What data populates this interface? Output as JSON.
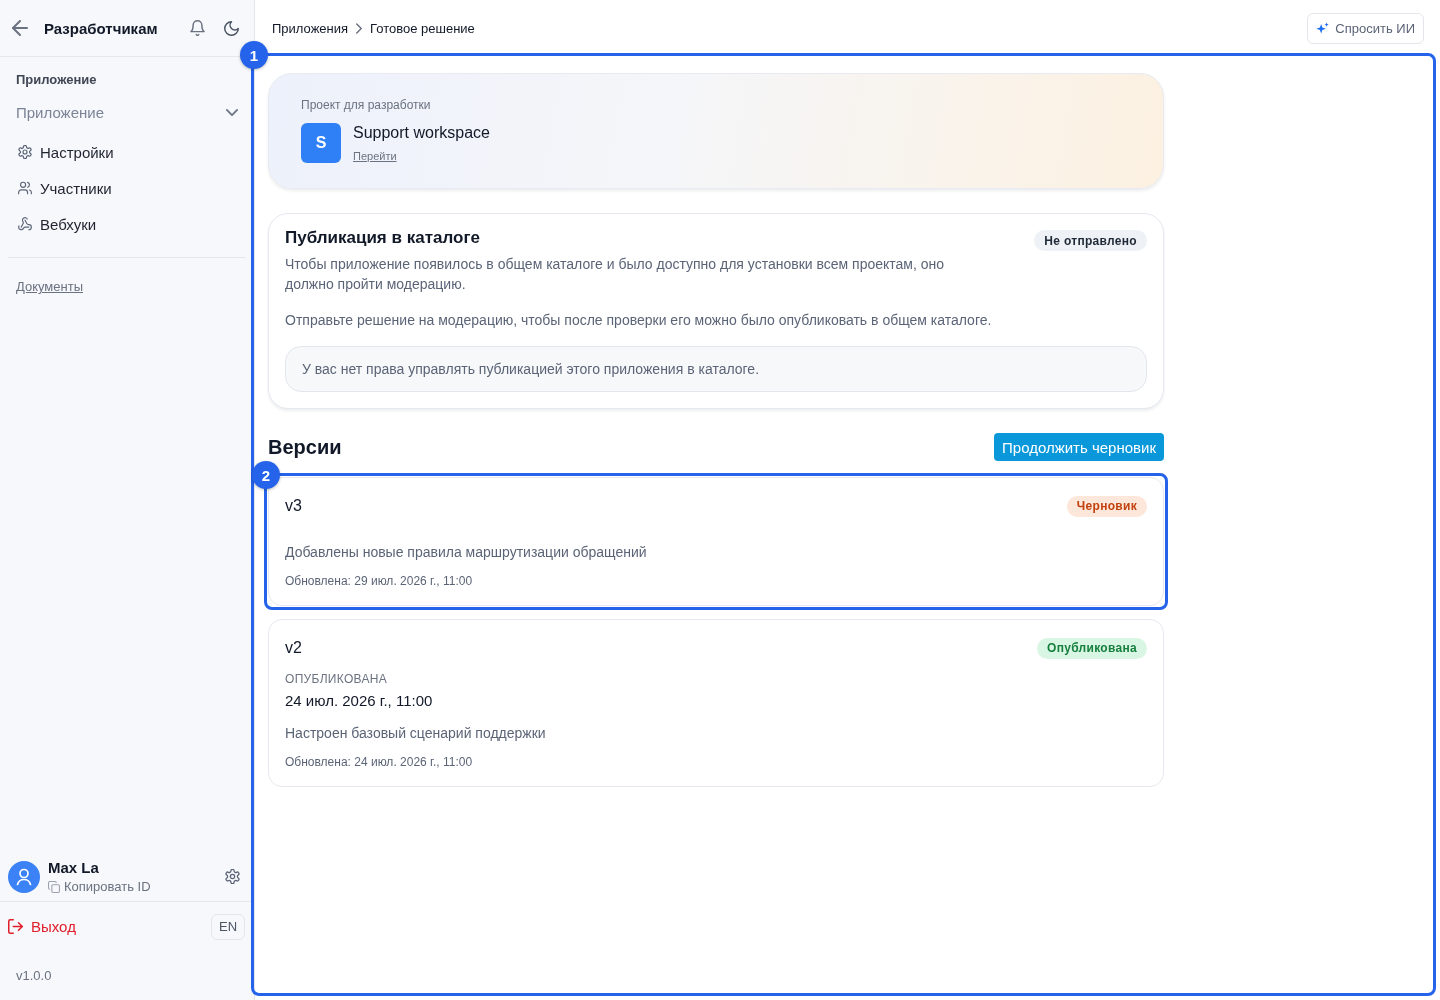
{
  "sidebar": {
    "title": "Разработчикам",
    "section_label": "Приложение",
    "app_select": {
      "placeholder": "Приложение"
    },
    "nav_items": [
      {
        "label": "Настройки",
        "selected": false
      },
      {
        "label": "Участники",
        "selected": false
      },
      {
        "label": "Вебхуки",
        "selected": false
      }
    ],
    "docs_link": "Документы",
    "user": {
      "name": "Max La",
      "copy_id": "Копировать ID"
    },
    "logout": "Выход",
    "language": "EN",
    "version": "v1.0.0"
  },
  "topbar": {
    "breadcrumbs": [
      "Приложения",
      "Готовое решение"
    ],
    "ask_ai_button": "Спросить ИИ"
  },
  "content": {
    "highlight": "1",
    "project_card": {
      "label": "Проект для разработки",
      "avatar": "S",
      "name": "Support workspace",
      "link": "Перейти"
    },
    "publication": {
      "title": "Публикация в каталоге",
      "status": {
        "label": "Не отправлено",
        "kind": "neutral"
      },
      "description": "Чтобы приложение появилось в общем каталоге и было доступно для установки всем проектам, оно должно пройти модерацию.",
      "hint": "Отправьте решение на модерацию, чтобы после проверки его можно было опубликовать в общем каталоге.",
      "notice": "У вас нет права управлять публикацией этого приложения в каталоге."
    },
    "versions": {
      "title": "Версии",
      "continue_button": "Продолжить черновик",
      "items": [
        {
          "name": "v3",
          "highlight": "2",
          "status": {
            "label": "Черновик",
            "kind": "draft"
          },
          "description": "Добавлены новые правила маршрутизации обращений",
          "updated": "Обновлена: 29 июл. 2026 г., 11:00"
        },
        {
          "name": "v2",
          "status": {
            "label": "Опубликована",
            "kind": "published"
          },
          "published": {
            "label": "ОПУБЛИКОВАНА",
            "date": "24 июл. 2026 г., 11:00"
          },
          "description": "Настроен базовый сценарий поддержки",
          "updated": "Обновлена: 24 июл. 2026 г., 11:00"
        }
      ]
    }
  }
}
